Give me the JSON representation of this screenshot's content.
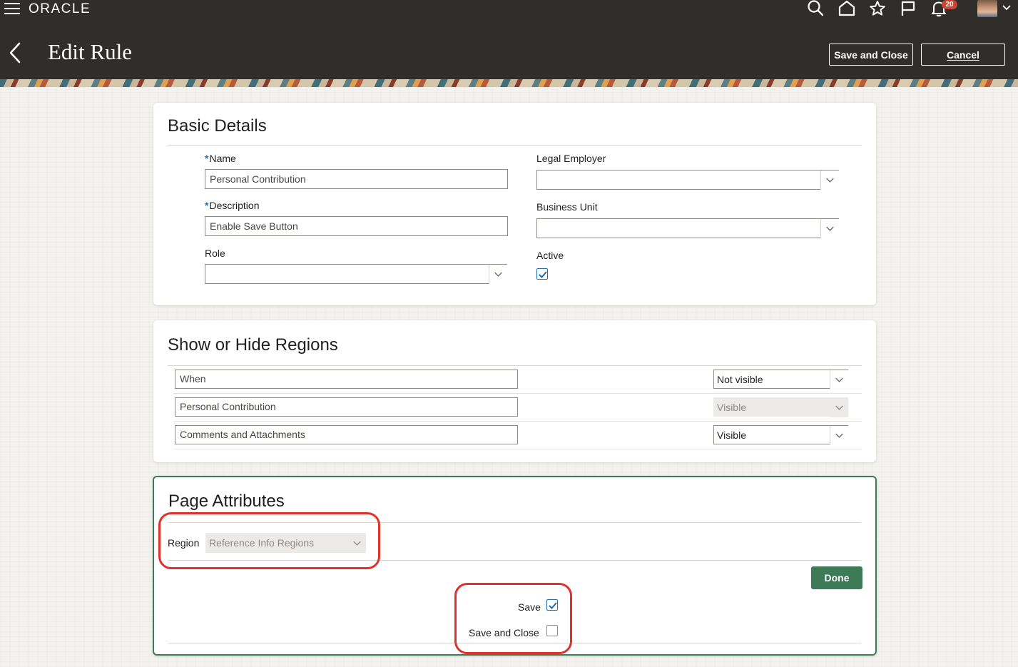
{
  "header": {
    "logo": "ORACLE",
    "notifications_count": "20",
    "page_title": "Edit Rule",
    "save_close_label": "Save and Close",
    "cancel_label": "Cancel",
    "icons": [
      "menu-icon",
      "search-icon",
      "home-icon",
      "star-icon",
      "flag-icon",
      "bell-icon",
      "avatar",
      "chevron-down-icon"
    ]
  },
  "basic_details": {
    "title": "Basic Details",
    "name_label": "Name",
    "name_value": "Personal Contribution",
    "description_label": "Description",
    "description_value": "Enable Save Button",
    "role_label": "Role",
    "role_value": "",
    "legal_employer_label": "Legal Employer",
    "legal_employer_value": "",
    "business_unit_label": "Business Unit",
    "business_unit_value": "",
    "active_label": "Active",
    "active_checked": true,
    "required_marker": "*"
  },
  "regions": {
    "title": "Show or Hide Regions",
    "rows": [
      {
        "name": "When",
        "visibility": "Not visible",
        "disabled": false
      },
      {
        "name": "Personal Contribution",
        "visibility": "Visible",
        "disabled": true
      },
      {
        "name": "Comments and Attachments",
        "visibility": "Visible",
        "disabled": false
      }
    ]
  },
  "page_attributes": {
    "title": "Page Attributes",
    "region_label": "Region",
    "region_value": "Reference Info Regions",
    "done_label": "Done",
    "save_label": "Save",
    "save_checked": true,
    "save_close_label": "Save and Close",
    "save_close_checked": false
  },
  "colors": {
    "header_bg": "#312d2a",
    "done_button": "#3d7a58",
    "highlight": "#e0322b",
    "checkbox_accent": "#1f6fb5",
    "badge": "#c74634"
  }
}
